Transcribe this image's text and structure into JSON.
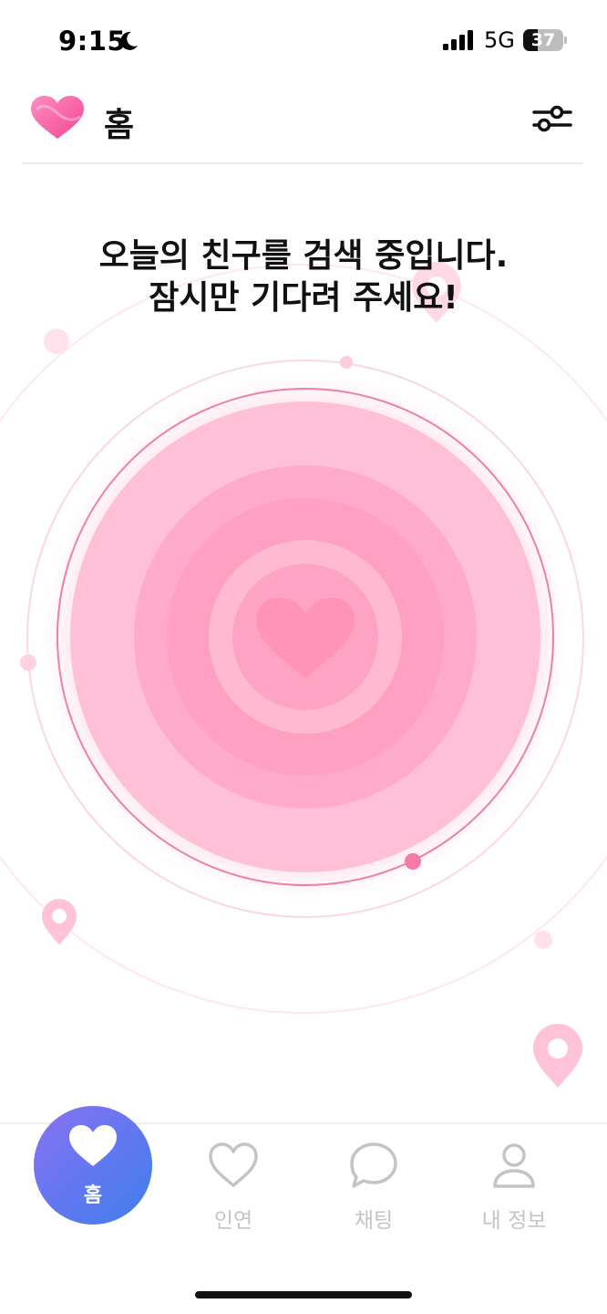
{
  "status_bar": {
    "time": "9:15",
    "network": "5G",
    "battery": "37",
    "battery_level": 0.37,
    "icons": [
      "moon-icon",
      "signal-icon",
      "battery-icon"
    ]
  },
  "header": {
    "title": "홈",
    "logo_icon": "heart-logo-icon",
    "filter_icon": "filter-sliders-icon"
  },
  "main": {
    "message_line1": "오늘의 친구를 검색 중입니다.",
    "message_line2": "잠시만 기다려 주세요!",
    "center_icon": "heart-icon",
    "marker_icon": "location-pin-icon"
  },
  "nav": {
    "items": [
      {
        "label": "홈",
        "icon": "heart-icon",
        "active": true
      },
      {
        "label": "인연",
        "icon": "heart-outline-icon",
        "active": false
      },
      {
        "label": "채팅",
        "icon": "chat-bubble-icon",
        "active": false
      },
      {
        "label": "내 정보",
        "icon": "user-icon",
        "active": false
      }
    ]
  },
  "colors": {
    "accent_pink": "#f77fb0",
    "radar_pink": "#ffbcd5",
    "nav_active_start": "#8a71f2",
    "nav_active_end": "#3f7fea",
    "nav_inactive": "#c4c4c4"
  }
}
